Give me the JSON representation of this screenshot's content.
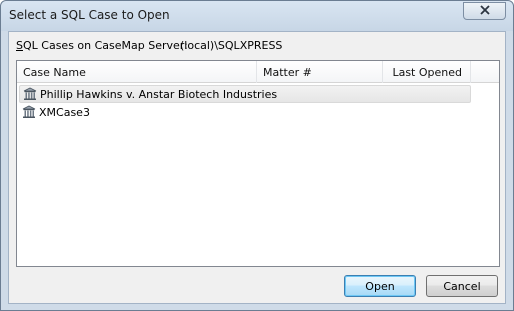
{
  "window": {
    "title": "Select a SQL Case to Open"
  },
  "server": {
    "label_accel": "S",
    "label_rest": "QL Cases on CaseMap Server:",
    "value": "(local)\\SQLXPRESS"
  },
  "list": {
    "columns": [
      "Case Name",
      "Matter #",
      "Last Opened"
    ],
    "rows": [
      {
        "name": "Phillip Hawkins v. Anstar Biotech Industries",
        "matter": "",
        "last_opened": "",
        "icon": "building-icon",
        "selected": true
      },
      {
        "name": "XMCase3",
        "matter": "",
        "last_opened": "",
        "icon": "building-icon",
        "selected": false
      }
    ]
  },
  "buttons": {
    "open": "Open",
    "cancel": "Cancel"
  },
  "colors": {
    "accent": "#3c7fb1",
    "title_bar": "#cfdbe8",
    "client_bg": "#f0f0f0"
  }
}
